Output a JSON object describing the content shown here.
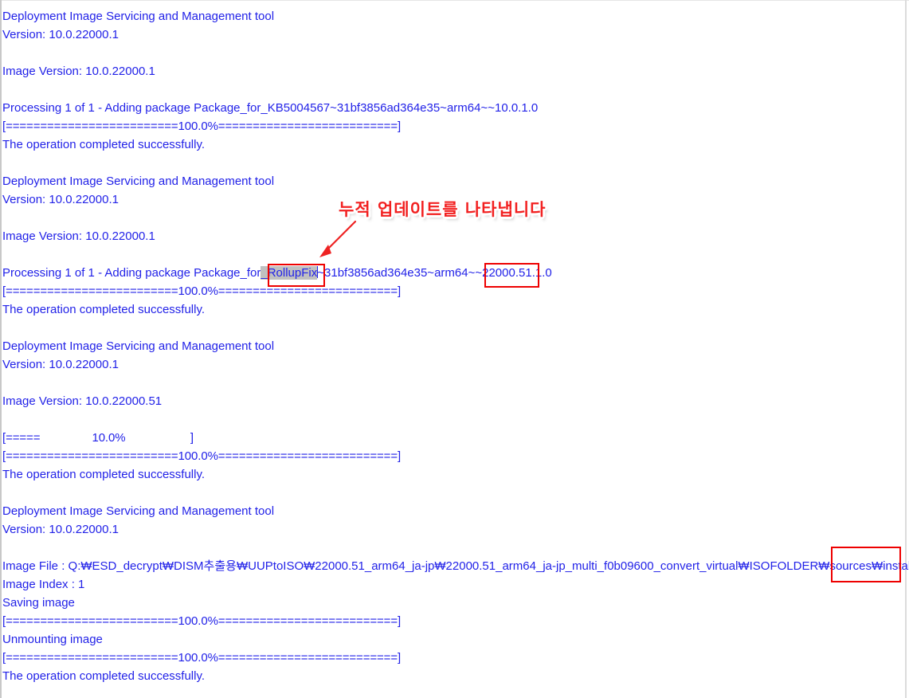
{
  "window": {
    "background": "#ffffff",
    "text_color": "#2222e8",
    "annotation_color": "#ee0000",
    "selection_color": "#c0c0c0"
  },
  "console": {
    "lines": [
      {
        "text": "Deployment Image Servicing and Management tool"
      },
      {
        "text": "Version: 10.0.22000.1"
      },
      {
        "text": ""
      },
      {
        "text": "Image Version: 10.0.22000.1"
      },
      {
        "text": ""
      },
      {
        "text": "Processing 1 of 1 - Adding package Package_for_KB5004567~31bf3856ad364e35~arm64~~10.0.1.0"
      },
      {
        "text": "[=========================100.0%==========================]"
      },
      {
        "text": "The operation completed successfully."
      },
      {
        "text": ""
      },
      {
        "text": "Deployment Image Servicing and Management tool"
      },
      {
        "text": "Version: 10.0.22000.1"
      },
      {
        "text": ""
      },
      {
        "text": "Image Version: 10.0.22000.1"
      },
      {
        "text": ""
      },
      {
        "text": "PROCESSING_ROLLUPFIX_LINE"
      },
      {
        "text": "[=========================100.0%==========================]"
      },
      {
        "text": "The operation completed successfully."
      },
      {
        "text": ""
      },
      {
        "text": "Deployment Image Servicing and Management tool"
      },
      {
        "text": "Version: 10.0.22000.1"
      },
      {
        "text": ""
      },
      {
        "text": "Image Version: 10.0.22000.51"
      },
      {
        "text": ""
      },
      {
        "text": "[=====                10.0%                    ]"
      },
      {
        "text": "[=========================100.0%==========================]"
      },
      {
        "text": "The operation completed successfully."
      },
      {
        "text": ""
      },
      {
        "text": "Deployment Image Servicing and Management tool"
      },
      {
        "text": "Version: 10.0.22000.1"
      },
      {
        "text": ""
      },
      {
        "text": "IMAGE_FILE_LINE"
      },
      {
        "text": "Image Index : 1"
      },
      {
        "text": "Saving image"
      },
      {
        "text": "[=========================100.0%==========================]"
      },
      {
        "text": "Unmounting image"
      },
      {
        "text": "[=========================100.0%==========================]"
      },
      {
        "text": "The operation completed successfully."
      }
    ],
    "rollupfix_line": {
      "prefix": "Processing 1 of 1 - Adding package Package_for",
      "selected": "_RollupFix",
      "middle": "~31bf3856ad364e35~arm64~~",
      "build": "22000.51",
      "suffix": ".1.0"
    },
    "image_file_line": {
      "label": "Image File : ",
      "path": "Q:₩ESD_decrypt₩DISM추출용₩UUPtoISO₩22000.51_arm64_ja-jp₩22000.51_arm64_ja-jp_multi_f0b09600_convert_virtual₩ISOFOLDER₩sources₩",
      "filename": "install.wim"
    }
  },
  "annotations": {
    "callout_text": "누적 업데이트를 나타냅니다",
    "boxes": [
      {
        "name": "rollupfix-highlight-box",
        "target": "_RollupFix"
      },
      {
        "name": "build-number-highlight-box",
        "target": "22000.51"
      },
      {
        "name": "install-wim-highlight-box",
        "target": "install.wim"
      }
    ]
  }
}
